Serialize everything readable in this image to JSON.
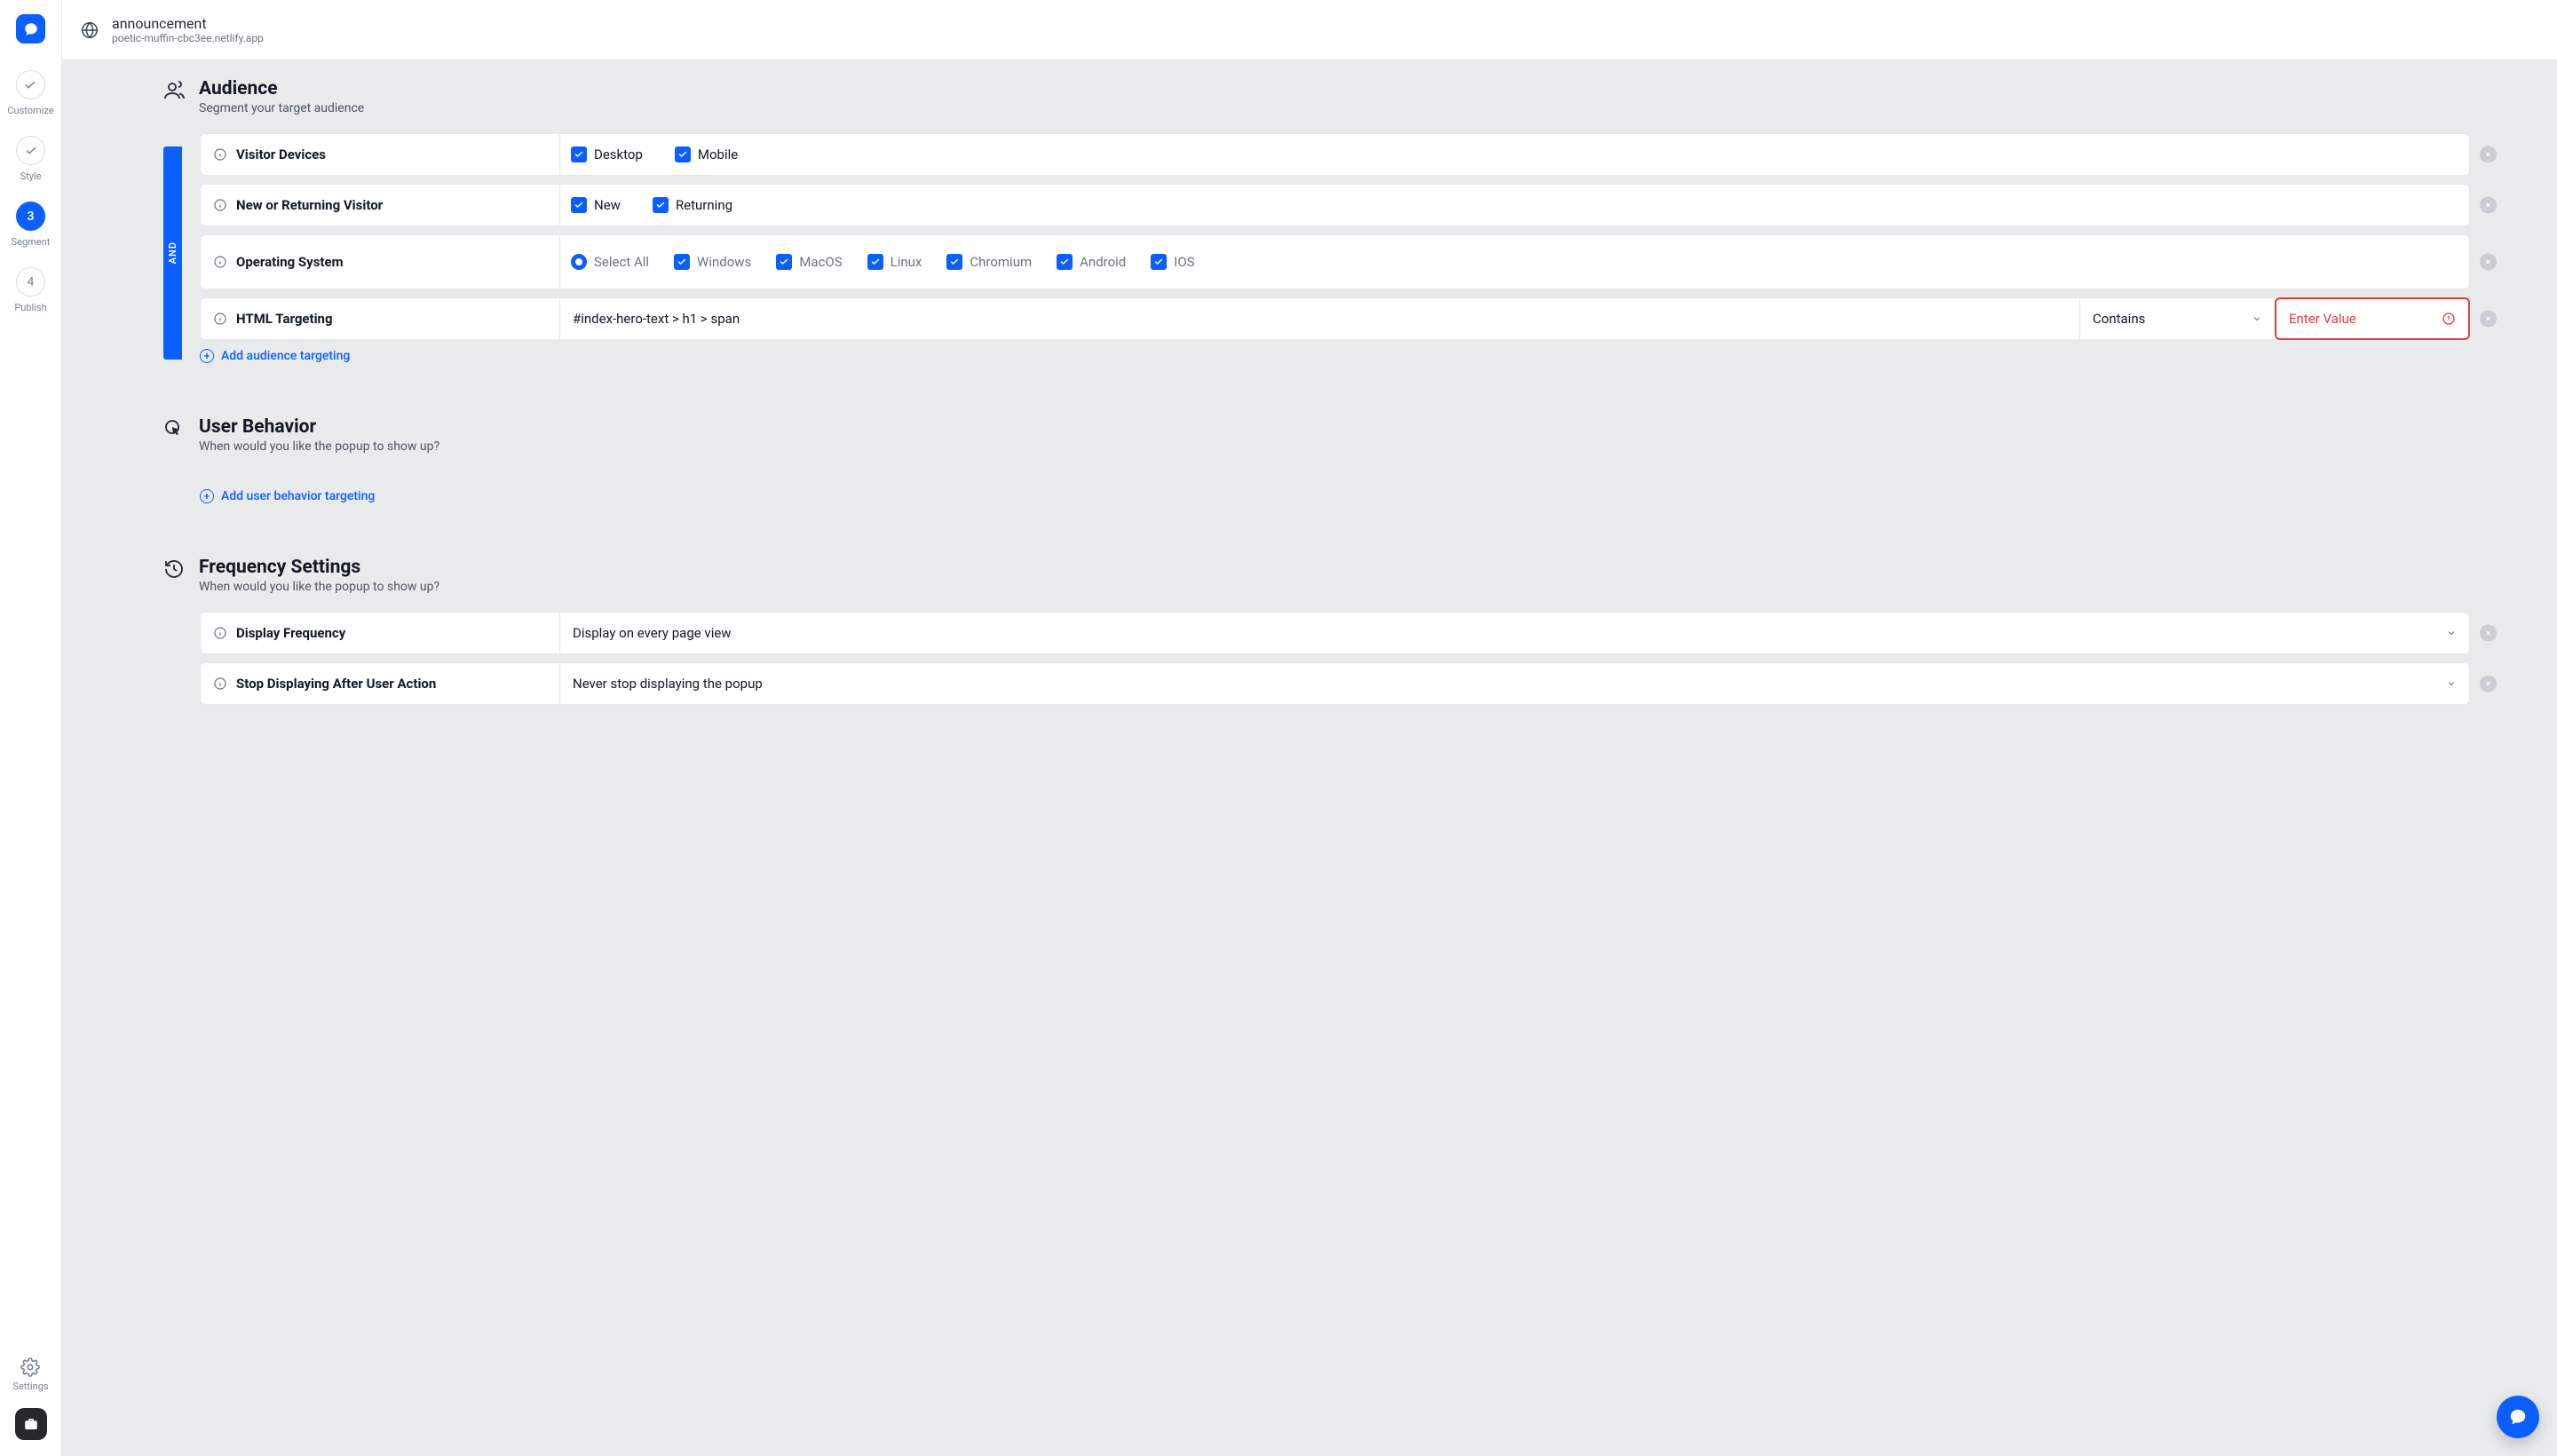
{
  "header": {
    "title": "announcement",
    "subtitle": "poetic-muffin-cbc3ee.netlify.app"
  },
  "steps": {
    "s1": {
      "label": "Customize"
    },
    "s2": {
      "label": "Style"
    },
    "s3": {
      "num": "3",
      "label": "Segment"
    },
    "s4": {
      "num": "4",
      "label": "Publish"
    }
  },
  "settings_label": "Settings",
  "side_strip": "AND",
  "sections": {
    "audience": {
      "title": "Audience",
      "subtitle": "Segment your target audience"
    },
    "behavior": {
      "title": "User Behavior",
      "subtitle": "When would you like the popup to show up?"
    },
    "frequency": {
      "title": "Frequency Settings",
      "subtitle": "When would you like the popup to show up?"
    }
  },
  "rows": {
    "devices": {
      "label": "Visitor Devices",
      "opts": {
        "desktop": "Desktop",
        "mobile": "Mobile"
      }
    },
    "visitor": {
      "label": "New or Returning Visitor",
      "opts": {
        "new": "New",
        "returning": "Returning"
      }
    },
    "os": {
      "label": "Operating System",
      "opts": {
        "selectall": "Select All",
        "windows": "Windows",
        "macos": "MacOS",
        "linux": "Linux",
        "chromium": "Chromium",
        "android": "Android",
        "ios": "IOS"
      }
    },
    "html": {
      "label": "HTML Targeting",
      "selector": "#index-hero-text > h1 > span",
      "operator": "Contains",
      "value_placeholder": "Enter Value"
    },
    "display_freq": {
      "label": "Display Frequency",
      "value": "Display on every page view"
    },
    "stop_display": {
      "label": "Stop Displaying After User Action",
      "value": "Never stop displaying the popup"
    }
  },
  "add_links": {
    "audience": "Add audience targeting",
    "behavior": "Add user behavior targeting"
  }
}
